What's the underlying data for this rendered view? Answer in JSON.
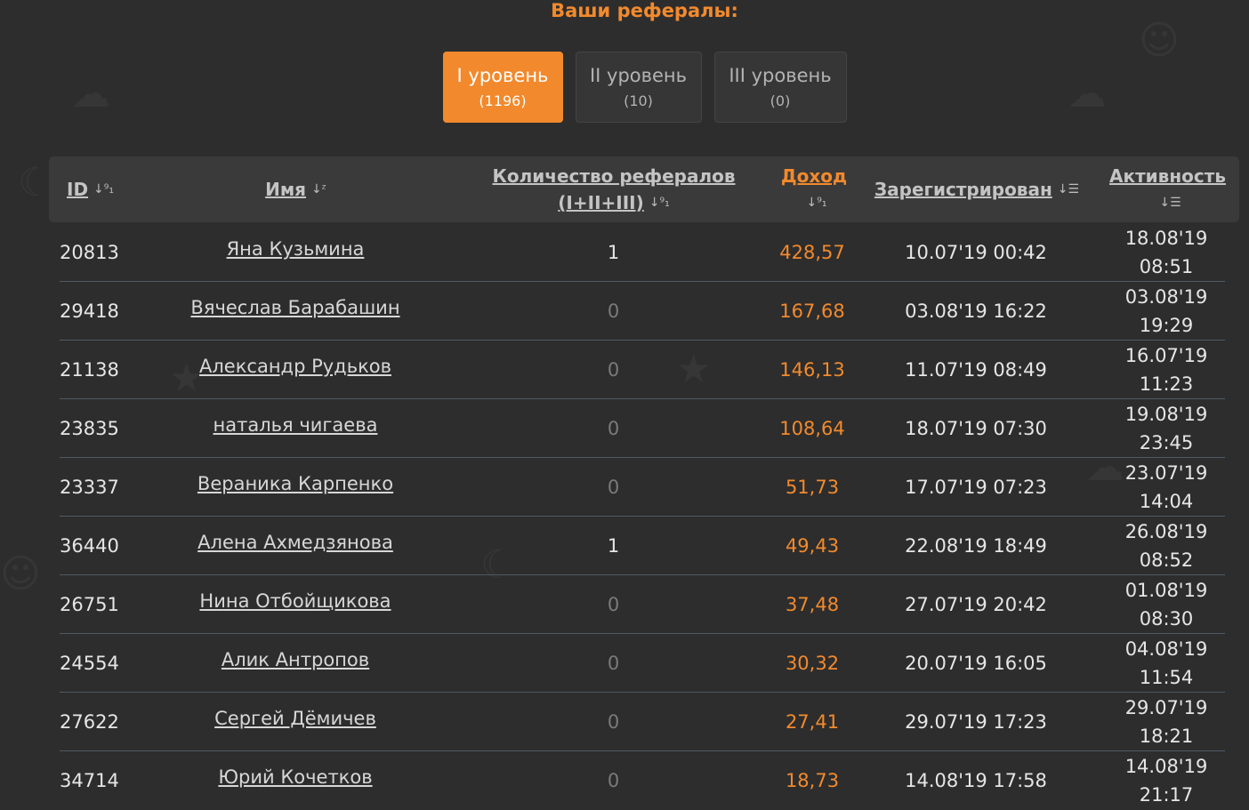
{
  "section_title": "Ваши рефералы:",
  "tabs": [
    {
      "label": "I уровень",
      "count": "(1196)",
      "active": true
    },
    {
      "label": "II уровень",
      "count": "(10)",
      "active": false
    },
    {
      "label": "III уровень",
      "count": "(0)",
      "active": false
    }
  ],
  "columns": {
    "id": "ID",
    "name": "Имя",
    "refs_line1": "Количество рефералов",
    "refs_line2": "(I+II+III)",
    "income": "Доход",
    "registered": "Зарегистрирован",
    "activity": "Активность"
  },
  "icons": {
    "sort_numeric": "sort-numeric-icon",
    "sort_alpha": "sort-alpha-icon",
    "sort_amount": "sort-amount-icon"
  },
  "colors": {
    "accent": "#f28a2d",
    "background": "#2d2d2d"
  },
  "rows": [
    {
      "id": "20813",
      "name": "Яна Кузьмина",
      "refs": "1",
      "income": "428,57",
      "registered": "10.07'19 00:42",
      "activity_date": "18.08'19",
      "activity_time": "08:51"
    },
    {
      "id": "29418",
      "name": "Вячеслав Барабашин",
      "refs": "0",
      "income": "167,68",
      "registered": "03.08'19 16:22",
      "activity_date": "03.08'19",
      "activity_time": "19:29"
    },
    {
      "id": "21138",
      "name": "Александр Рудьков",
      "refs": "0",
      "income": "146,13",
      "registered": "11.07'19 08:49",
      "activity_date": "16.07'19",
      "activity_time": "11:23"
    },
    {
      "id": "23835",
      "name": "наталья чигаева",
      "refs": "0",
      "income": "108,64",
      "registered": "18.07'19 07:30",
      "activity_date": "19.08'19",
      "activity_time": "23:45"
    },
    {
      "id": "23337",
      "name": "Вераника Карпенко",
      "refs": "0",
      "income": "51,73",
      "registered": "17.07'19 07:23",
      "activity_date": "23.07'19",
      "activity_time": "14:04"
    },
    {
      "id": "36440",
      "name": "Алена Ахмедзянова",
      "refs": "1",
      "income": "49,43",
      "registered": "22.08'19 18:49",
      "activity_date": "26.08'19",
      "activity_time": "08:52"
    },
    {
      "id": "26751",
      "name": "Нина Отбойщикова",
      "refs": "0",
      "income": "37,48",
      "registered": "27.07'19 20:42",
      "activity_date": "01.08'19",
      "activity_time": "08:30"
    },
    {
      "id": "24554",
      "name": "Алик Антропов",
      "refs": "0",
      "income": "30,32",
      "registered": "20.07'19 16:05",
      "activity_date": "04.08'19",
      "activity_time": "11:54"
    },
    {
      "id": "27622",
      "name": "Сергей Дёмичев",
      "refs": "0",
      "income": "27,41",
      "registered": "29.07'19 17:23",
      "activity_date": "29.07'19",
      "activity_time": "18:21"
    },
    {
      "id": "34714",
      "name": "Юрий Кочетков",
      "refs": "0",
      "income": "18,73",
      "registered": "14.08'19 17:58",
      "activity_date": "14.08'19",
      "activity_time": "21:17"
    }
  ]
}
